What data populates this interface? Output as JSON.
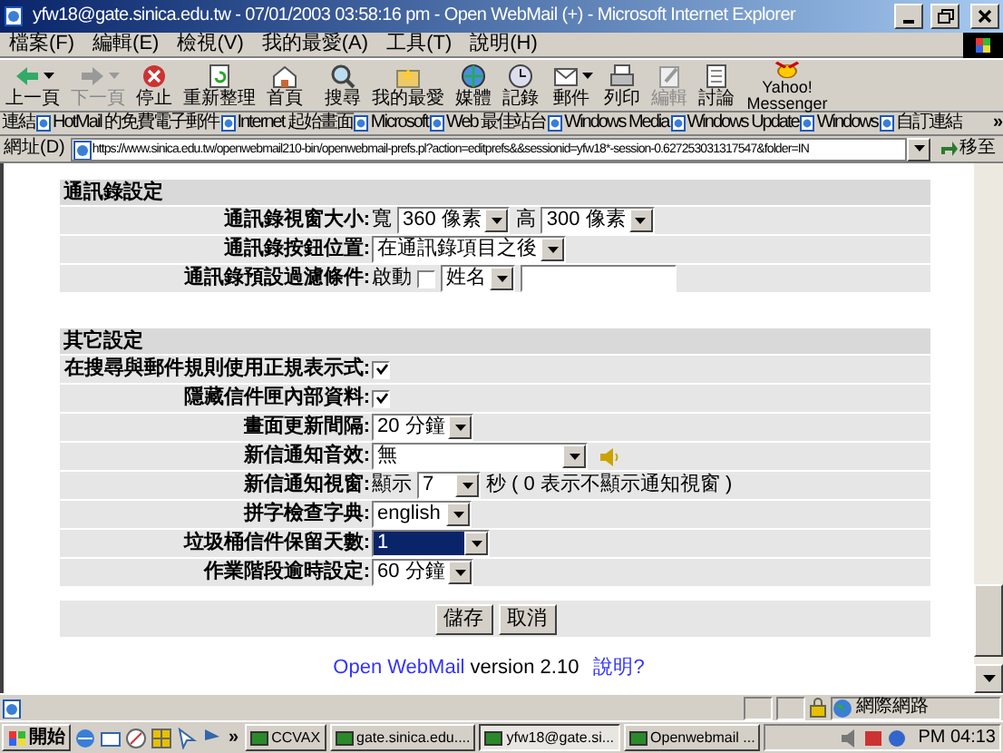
{
  "window": {
    "title": "yfw18@gate.sinica.edu.tw - 07/01/2003 03:58:16 pm - Open WebMail (+) - Microsoft Internet Explorer"
  },
  "menu": [
    "檔案(F)",
    "編輯(E)",
    "檢視(V)",
    "我的最愛(A)",
    "工具(T)",
    "說明(H)"
  ],
  "toolbar": [
    {
      "label": "上一頁",
      "disabled": false,
      "dropdown": true
    },
    {
      "label": "下一頁",
      "disabled": true,
      "dropdown": true
    },
    {
      "label": "停止",
      "disabled": false,
      "dropdown": false
    },
    {
      "label": "重新整理",
      "disabled": false,
      "dropdown": false
    },
    {
      "label": "首頁",
      "disabled": false,
      "dropdown": false
    },
    {
      "label": "搜尋",
      "disabled": false,
      "dropdown": false
    },
    {
      "label": "我的最愛",
      "disabled": false,
      "dropdown": false
    },
    {
      "label": "媒體",
      "disabled": false,
      "dropdown": false
    },
    {
      "label": "記錄",
      "disabled": false,
      "dropdown": false
    },
    {
      "label": "郵件",
      "disabled": false,
      "dropdown": true
    },
    {
      "label": "列印",
      "disabled": false,
      "dropdown": false
    },
    {
      "label": "編輯",
      "disabled": true,
      "dropdown": false
    },
    {
      "label": "討論",
      "disabled": false,
      "dropdown": false
    },
    {
      "label": "Yahoo! Messenger",
      "disabled": false,
      "dropdown": false
    }
  ],
  "links_bar": {
    "label": "連結",
    "overflow": "»",
    "items": [
      "HotMail 的免費電子郵件",
      "Internet 起始畫面",
      "Microsoft",
      "Web 最佳站台",
      "Windows Media",
      "Windows Update",
      "Windows",
      "自訂連結"
    ]
  },
  "address_bar": {
    "label": "網址(D)",
    "url": "https://www.sinica.edu.tw/openwebmail210-bin/openwebmail-prefs.pl?action=editprefs&&sessionid=yfw18*-session-0.627253031317547&folder=IN",
    "go": "移至"
  },
  "sections": [
    {
      "title": "通訊錄設定",
      "rows": [
        {
          "label": "通訊錄視窗大小:",
          "controls": [
            {
              "kind": "text",
              "text": "寬"
            },
            {
              "kind": "select",
              "value": "360 像素",
              "highlighted": false
            },
            {
              "kind": "text",
              "text": "高"
            },
            {
              "kind": "select",
              "value": "300 像素",
              "highlighted": false
            }
          ]
        },
        {
          "label": "通訊錄按鈕位置:",
          "controls": [
            {
              "kind": "select",
              "value": "在通訊錄項目之後",
              "highlighted": false
            }
          ]
        },
        {
          "label": "通訊錄預設過濾條件:",
          "controls": [
            {
              "kind": "text",
              "text": "啟動"
            },
            {
              "kind": "checkbox",
              "checked": false
            },
            {
              "kind": "select",
              "value": "姓名",
              "highlighted": false
            },
            {
              "kind": "input"
            }
          ]
        }
      ]
    },
    {
      "title": "其它設定",
      "rows": [
        {
          "label": "在搜尋與郵件規則使用正規表示式:",
          "controls": [
            {
              "kind": "checkbox",
              "checked": true
            }
          ]
        },
        {
          "label": "隱藏信件匣內部資料:",
          "controls": [
            {
              "kind": "checkbox",
              "checked": true
            }
          ]
        },
        {
          "label": "畫面更新間隔:",
          "controls": [
            {
              "kind": "select",
              "value": "20 分鐘",
              "highlighted": false
            }
          ]
        },
        {
          "label": "新信通知音效:",
          "controls": [
            {
              "kind": "select",
              "value": "無",
              "highlighted": false
            },
            {
              "kind": "sound"
            }
          ]
        },
        {
          "label": "新信通知視窗:",
          "controls": [
            {
              "kind": "text",
              "text": "顯示"
            },
            {
              "kind": "select",
              "value": "7",
              "highlighted": false
            },
            {
              "kind": "text",
              "text": "秒 ( 0 表示不顯示通知視窗 )"
            }
          ]
        },
        {
          "label": "拼字檢查字典:",
          "controls": [
            {
              "kind": "select",
              "value": "english",
              "highlighted": false
            }
          ]
        },
        {
          "label": "垃圾桶信件保留天數:",
          "controls": [
            {
              "kind": "select",
              "value": "1",
              "highlighted": true
            }
          ]
        },
        {
          "label": "作業階段逾時設定:",
          "controls": [
            {
              "kind": "select",
              "value": "60 分鐘",
              "highlighted": false
            }
          ]
        }
      ]
    }
  ],
  "buttons": [
    "儲存",
    "取消"
  ],
  "footer": {
    "product": "Open WebMail",
    "version": "version 2.10",
    "help": "說明?"
  },
  "status_bar": {
    "zone": "網際網路"
  },
  "taskbar": {
    "start": "開始",
    "overflow": "»",
    "tasks": [
      {
        "label": "CCVAX",
        "selected": false
      },
      {
        "label": "gate.sinica.edu....",
        "selected": false
      },
      {
        "label": "yfw18@gate.si...",
        "selected": true
      },
      {
        "label": "Openwebmail ...",
        "selected": false
      }
    ],
    "clock": "PM 04:13"
  }
}
